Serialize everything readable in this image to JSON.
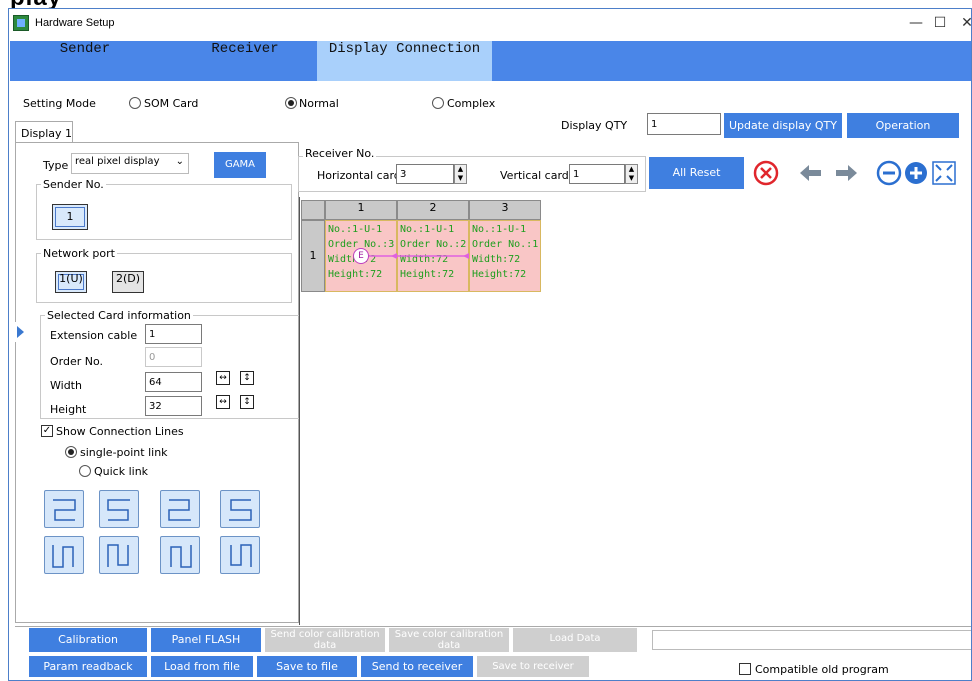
{
  "background_text": "play",
  "window": {
    "title": "Hardware Setup",
    "minimize": "—",
    "maximize": "☐",
    "close": "✕"
  },
  "tabs": [
    {
      "label": "Sender"
    },
    {
      "label": "Receiver"
    },
    {
      "label": "Display Connection",
      "active": true
    }
  ],
  "setting_mode": {
    "label": "Setting Mode",
    "options": [
      "SOM Card",
      "Normal",
      "Complex"
    ],
    "selected": "Normal"
  },
  "display_tab": "Display 1",
  "display_qty": {
    "label": "Display QTY",
    "value": "1",
    "update_button": "Update display QTY",
    "operation_button": "Operation"
  },
  "left": {
    "type_label": "Type",
    "type_value": "real pixel display",
    "gama_button": "GAMA",
    "sender_no": {
      "title": "Sender No.",
      "value": "1"
    },
    "network_port": {
      "title": "Network port",
      "ports": [
        "1(U)",
        "2(D)"
      ],
      "selected": "1(U)"
    },
    "card_info": {
      "title": "Selected Card information",
      "fields": [
        {
          "label": "Extension cable",
          "value": "1"
        },
        {
          "label": "Order No.",
          "value": "0"
        },
        {
          "label": "Width",
          "value": "64"
        },
        {
          "label": "Height",
          "value": "32"
        }
      ]
    },
    "show_lines": {
      "label": "Show Connection Lines",
      "checked": true
    },
    "link_modes": [
      {
        "label": "single-point link",
        "selected": true
      },
      {
        "label": "Quick link",
        "selected": false
      }
    ]
  },
  "receiver": {
    "title": "Receiver No.",
    "horizontal_label": "Horizontal card",
    "horizontal_value": "3",
    "vertical_label": "Vertical card",
    "vertical_value": "1",
    "all_reset": "All Reset"
  },
  "grid": {
    "columns": [
      "1",
      "2",
      "3"
    ],
    "rows": [
      "1"
    ],
    "cells": [
      {
        "no": "No.:1-U-1",
        "order": "Order No.:3",
        "width": "Width:72",
        "height": "Height:72"
      },
      {
        "no": "No.:1-U-1",
        "order": "Order No.:2",
        "width": "Width:72",
        "height": "Height:72"
      },
      {
        "no": "No.:1-U-1",
        "order": "Order No.:1",
        "width": "Width:72",
        "height": "Height:72"
      }
    ],
    "marker": "E"
  },
  "bottom": {
    "row1": [
      {
        "label": "Calibration",
        "enabled": true
      },
      {
        "label": "Panel FLASH",
        "enabled": true
      },
      {
        "label": "Send color calibration data",
        "enabled": false
      },
      {
        "label": "Save color calibration data",
        "enabled": false
      },
      {
        "label": "Load Data",
        "enabled": false
      }
    ],
    "row2": [
      {
        "label": "Param readback",
        "enabled": true
      },
      {
        "label": "Load from file",
        "enabled": true
      },
      {
        "label": "Save to file",
        "enabled": true
      },
      {
        "label": "Send to receiver",
        "enabled": true
      },
      {
        "label": "Save to receiver",
        "enabled": false
      }
    ],
    "compatible": {
      "label": "Compatible old program",
      "checked": false
    }
  },
  "colors": {
    "accent": "#4a86e8",
    "active_tab": "#a9d0fb",
    "cell_fill": "#f9c6c6",
    "cell_text": "#1e9e1e",
    "disabled": "#cfcfcf"
  },
  "icons": [
    "cancel-icon",
    "undo-icon",
    "redo-icon",
    "zoom-out-icon",
    "zoom-in-icon",
    "fit-icon",
    "expand-arrow-icon"
  ]
}
